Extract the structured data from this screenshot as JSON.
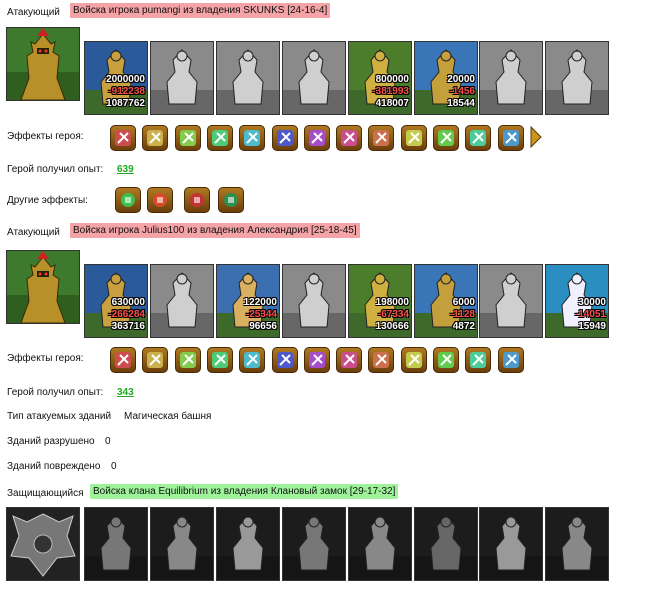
{
  "battle": [
    {
      "role": "Атакующий",
      "banner": "Войска игрока pumangi из владения SKUNKS [24-16-4]",
      "hero_icon": "golden-knight-hero",
      "units": [
        {
          "icon": "archer-unit",
          "active": true,
          "n1": "2000000",
          "n2": "-912238",
          "n3": "1087762"
        },
        {
          "icon": "armored-soldier-unit",
          "active": false
        },
        {
          "icon": "cavalry-unit",
          "active": false
        },
        {
          "icon": "griffin-unit",
          "active": false
        },
        {
          "icon": "golden-archer-unit",
          "active": true,
          "n1": "800000",
          "n2": "-381993",
          "n3": "418007"
        },
        {
          "icon": "crossbowman-unit",
          "active": true,
          "n1": "20000",
          "n2": "-1456",
          "n3": "18544"
        },
        {
          "icon": "dark-warrior-unit",
          "active": false
        },
        {
          "icon": "ghost-rider-unit",
          "active": false
        }
      ],
      "effects_label": "Эффекты героя:",
      "effects": [
        "sword-icon",
        "handshake-icon",
        "hand-icon",
        "crest-icon",
        "castle-icon",
        "shield-icon",
        "cog-icon",
        "ornament-icon",
        "web-icon",
        "armor-icon",
        "ring-icon",
        "tent-icon",
        "dagger-icon",
        "more-arrow-icon"
      ],
      "exp_label": "Герой получил опыт:",
      "exp_value": "639",
      "other_label": "Другие эффекты:",
      "other_effects": [
        "potion-icon",
        "shield-bonus-icon",
        "heart-icon",
        "cannon-icon"
      ]
    },
    {
      "role": "Атакующий",
      "banner": "Войска игрока Julius100 из владения Александрия [25-18-45]",
      "hero_icon": "golden-knight-hero",
      "units": [
        {
          "icon": "archer-unit",
          "active": true,
          "n1": "630000",
          "n2": "-266284",
          "n3": "363716"
        },
        {
          "icon": "armored-soldier-unit",
          "active": false
        },
        {
          "icon": "cavalry-unit",
          "active": true,
          "n1": "122000",
          "n2": "-25344",
          "n3": "96656"
        },
        {
          "icon": "griffin-unit",
          "active": false
        },
        {
          "icon": "golden-archer-unit",
          "active": true,
          "n1": "198000",
          "n2": "-67334",
          "n3": "130666"
        },
        {
          "icon": "crossbowman-unit",
          "active": true,
          "n1": "6000",
          "n2": "-1128",
          "n3": "4872"
        },
        {
          "icon": "dark-warrior-unit",
          "active": false
        },
        {
          "icon": "mage-unit",
          "active": true,
          "n1": "30000",
          "n2": "-14051",
          "n3": "15949"
        }
      ],
      "effects_label": "Эффекты героя:",
      "effects": [
        "sword-icon",
        "handshake-icon",
        "hand-icon",
        "crest-icon",
        "castle-icon",
        "shield-icon",
        "shield2-icon",
        "ornament-icon",
        "web-icon",
        "armor-icon",
        "ring-icon",
        "tent-icon",
        "dagger-icon"
      ],
      "exp_label": "Герой получил опыт:",
      "exp_value": "343",
      "buildings_type_label": "Тип атакуемых зданий",
      "buildings_type_value": "Магическая башня",
      "destroyed_label": "Зданий разрушено",
      "destroyed_value": "0",
      "damaged_label": "Зданий повреждено",
      "damaged_value": "0"
    },
    {
      "role": "Защищающийся",
      "banner": "Войска клана Equilibrium из владения Клановый замок [29-17-32]",
      "hero_icon": "dark-emblem-hero",
      "units": [
        {
          "icon": "dragon-unit",
          "active": false
        },
        {
          "icon": "demon-unit",
          "active": false
        },
        {
          "icon": "fiend-unit",
          "active": false
        },
        {
          "icon": "gargoyle-unit",
          "active": false
        },
        {
          "icon": "beast-unit",
          "active": false
        },
        {
          "icon": "spider-unit",
          "active": false
        },
        {
          "icon": "wraith-unit",
          "active": false
        },
        {
          "icon": "imp-unit",
          "active": false
        }
      ]
    }
  ],
  "colors": {
    "attacker_banner": "#f4a3a6",
    "defender_banner": "#9ef29a",
    "exp_link": "#22aa22",
    "loss": "#ff4b4b"
  }
}
